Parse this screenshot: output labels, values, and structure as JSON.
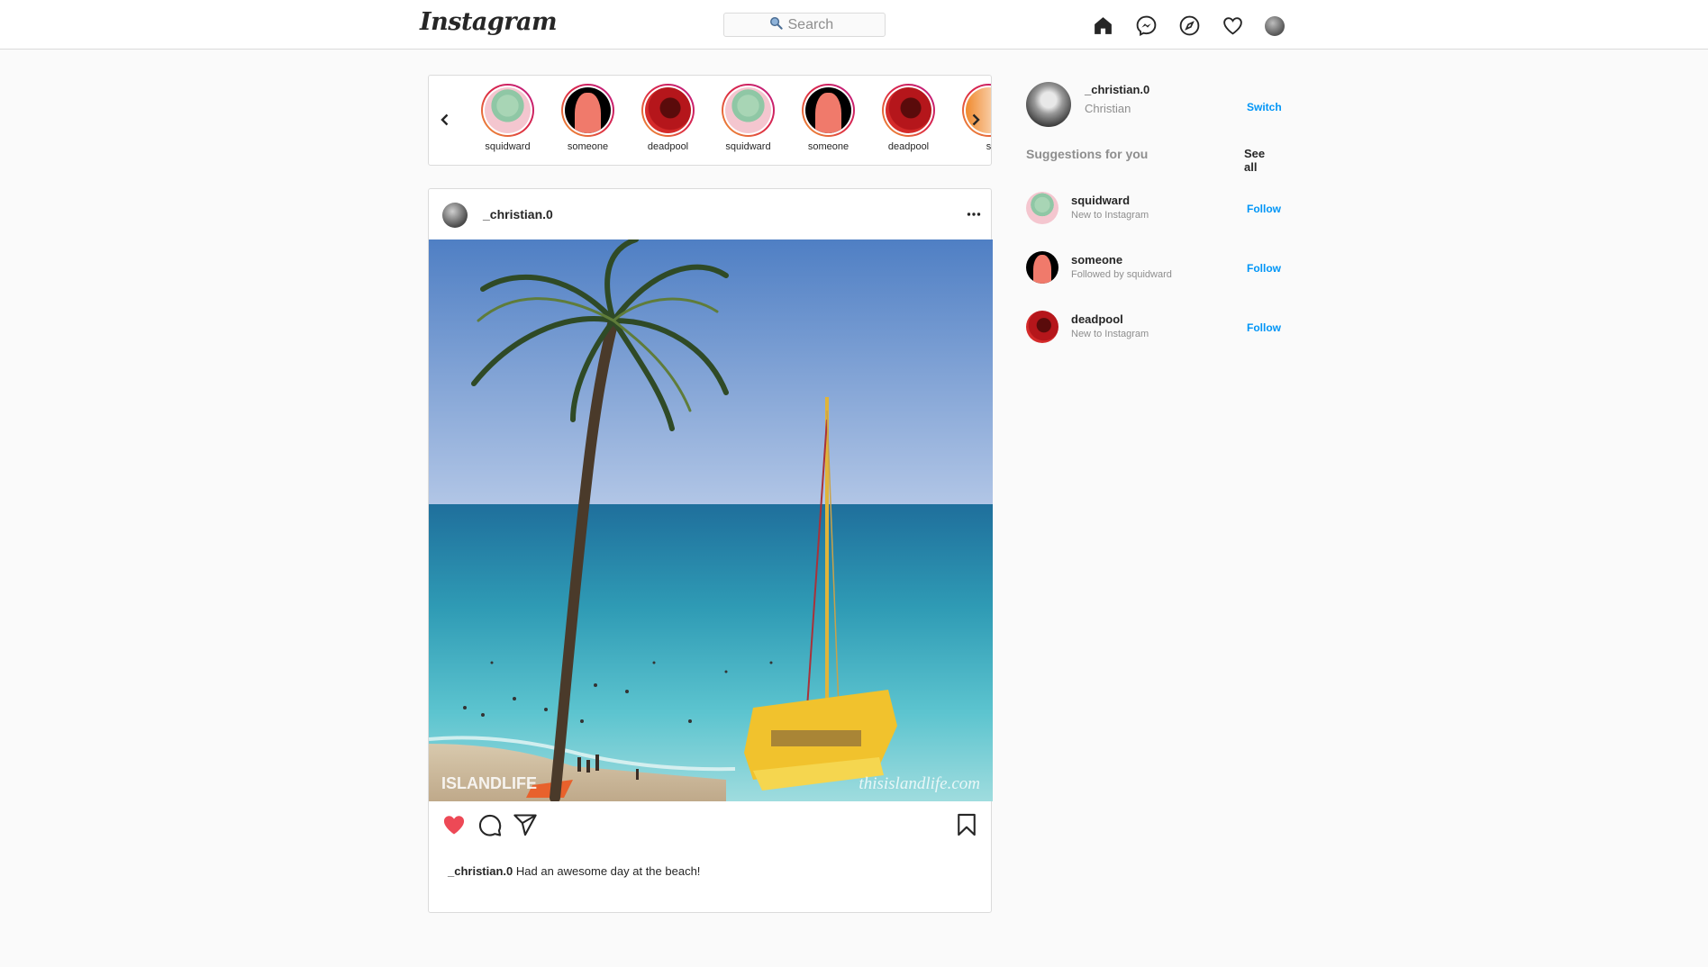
{
  "nav": {
    "logo": "Instagram",
    "search_placeholder": "Search",
    "icons": [
      "home-icon",
      "messenger-icon",
      "explore-icon",
      "activity-heart-icon",
      "profile-avatar"
    ]
  },
  "stories": [
    {
      "name": "squidward",
      "avatar": "squidward"
    },
    {
      "name": "someone",
      "avatar": "someone"
    },
    {
      "name": "deadpool",
      "avatar": "deadpool"
    },
    {
      "name": "squidward",
      "avatar": "squidward"
    },
    {
      "name": "someone",
      "avatar": "someone"
    },
    {
      "name": "deadpool",
      "avatar": "deadpool"
    },
    {
      "name": "s",
      "avatar": "partial"
    }
  ],
  "post": {
    "username": "_christian.0",
    "image_watermark_left": "ISLANDLIFE",
    "image_watermark_right": "thisislandlife.com",
    "liked": true,
    "caption_user": "_christian.0",
    "caption_text": "Had an awesome day at the beach!"
  },
  "sidebar": {
    "profile": {
      "username": "_christian.0",
      "fullname": "Christian",
      "switch_label": "Switch"
    },
    "suggestions_title": "Suggestions for you",
    "see_all": "See all",
    "suggestions": [
      {
        "username": "squidward",
        "sub": "New to Instagram",
        "action": "Follow"
      },
      {
        "username": "someone",
        "sub": "Followed by squidward",
        "action": "Follow"
      },
      {
        "username": "deadpool",
        "sub": "New to Instagram",
        "action": "Follow"
      }
    ]
  },
  "colors": {
    "accent_blue": "#0095f6",
    "like_red": "#ed4956",
    "border": "#dbdbdb",
    "background": "#fafafa"
  }
}
